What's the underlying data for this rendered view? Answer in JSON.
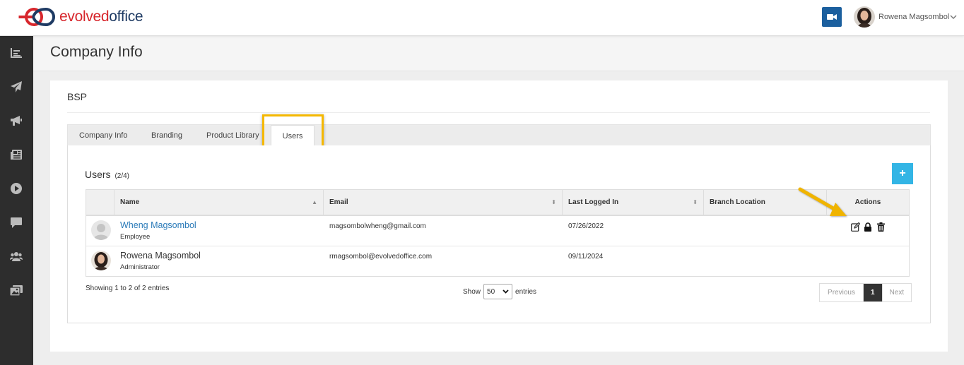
{
  "header": {
    "logo_part1": "evolved",
    "logo_part2": "office",
    "user_name": "Rowena Magsombol",
    "brand_color": "#d7262c",
    "brand_color_2": "#1e3a63"
  },
  "sidebar": {
    "items": [
      {
        "icon": "chart-icon"
      },
      {
        "icon": "paper-plane-icon"
      },
      {
        "icon": "megaphone-icon"
      },
      {
        "icon": "newspaper-icon"
      },
      {
        "icon": "play-circle-icon"
      },
      {
        "icon": "comment-icon"
      },
      {
        "icon": "users-icon"
      },
      {
        "icon": "images-icon"
      }
    ]
  },
  "page": {
    "title": "Company Info",
    "company_name": "BSP"
  },
  "tabs": [
    {
      "label": "Company Info",
      "active": false
    },
    {
      "label": "Branding",
      "active": false
    },
    {
      "label": "Product Library",
      "active": false
    },
    {
      "label": "Users",
      "active": true
    }
  ],
  "users_section": {
    "title": "Users",
    "count": "(2/4)",
    "add_label": "+"
  },
  "table": {
    "columns": [
      "Name",
      "Email",
      "Last Logged In",
      "Branch Location",
      "Actions"
    ],
    "rows": [
      {
        "name": "Wheng Magsombol",
        "role": "Employee",
        "email": "magsombolwheng@gmail.com",
        "last_login": "07/26/2022",
        "branch": ""
      },
      {
        "name": "Rowena Magsombol",
        "role": "Administrator",
        "email": "rmagsombol@evolvedoffice.com",
        "last_login": "09/11/2024",
        "branch": ""
      }
    ]
  },
  "footer": {
    "info": "Showing 1 to 2 of 2 entries",
    "show_label": "Show",
    "entries_value": "50",
    "entries_label": "entries",
    "prev": "Previous",
    "current_page": "1",
    "next": "Next"
  },
  "colors": {
    "accent": "#33b5e5",
    "highlight": "#f5b800",
    "link": "#2a7ab8"
  }
}
